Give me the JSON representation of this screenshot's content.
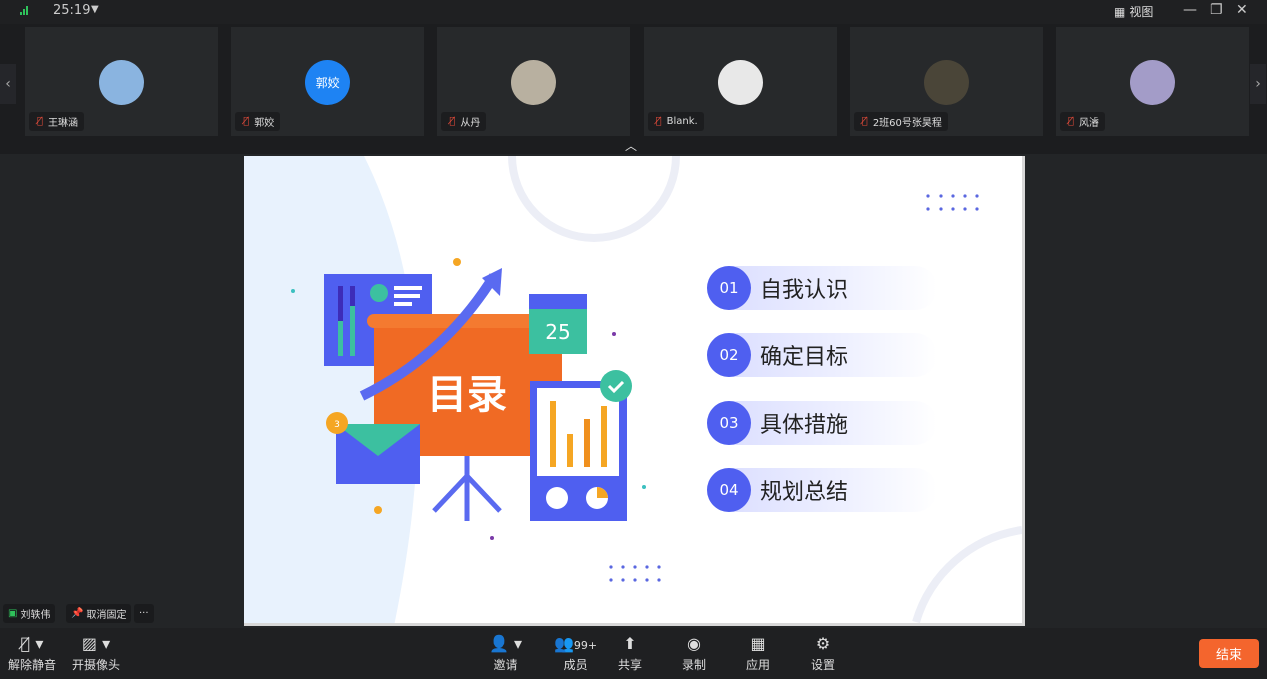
{
  "topbar": {
    "time": "25:19",
    "view_label": "视图"
  },
  "participants": [
    {
      "name": "王琳涵",
      "avatar": "photo",
      "color": "#8ab4e0"
    },
    {
      "name": "郭姣",
      "avatar": "郭姣",
      "color": "#1e83f3"
    },
    {
      "name": "从丹",
      "avatar": "photo",
      "color": "#b8b0a0"
    },
    {
      "name": "Blank.",
      "avatar": "photo",
      "color": "#e8e8e8"
    },
    {
      "name": "2班60号张昊程",
      "avatar": "photo",
      "color": "#4a4538"
    },
    {
      "name": "风濬",
      "avatar": "photo",
      "color": "#a39cc8"
    }
  ],
  "slide": {
    "title": "目录",
    "calendar_day": "25",
    "badge_count": "3",
    "items": [
      {
        "num": "01",
        "label": "自我认识"
      },
      {
        "num": "02",
        "label": "确定目标"
      },
      {
        "num": "03",
        "label": "具体措施"
      },
      {
        "num": "04",
        "label": "规划总结"
      }
    ]
  },
  "pinned": {
    "speaker": "刘轶伟",
    "unpin_label": "取消固定",
    "more_label": "···"
  },
  "toolbar": {
    "unmute": "解除静音",
    "camera": "开摄像头",
    "invite": "邀请",
    "members": "成员",
    "members_count": "99+",
    "share": "共享",
    "record": "录制",
    "apps": "应用",
    "settings": "设置",
    "end": "结束"
  }
}
